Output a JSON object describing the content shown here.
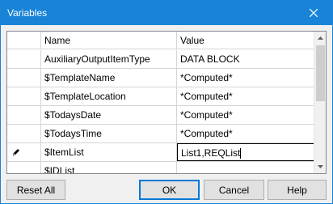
{
  "window": {
    "title": "Variables"
  },
  "grid": {
    "columns": [
      "Name",
      "Value"
    ],
    "rows": [
      {
        "name": "AuxiliaryOutputItemType",
        "value": "DATA BLOCK"
      },
      {
        "name": "$TemplateName",
        "value": "*Computed*"
      },
      {
        "name": "$TemplateLocation",
        "value": "*Computed*"
      },
      {
        "name": "$TodaysDate",
        "value": "*Computed*"
      },
      {
        "name": "$TodaysTime",
        "value": "*Computed*"
      },
      {
        "name": "$ItemList",
        "value": "List1,REQList"
      },
      {
        "name": "$IDList",
        "value": ""
      }
    ]
  },
  "buttons": {
    "reset": "Reset All",
    "ok": "OK",
    "cancel": "Cancel",
    "help": "Help"
  },
  "colors": {
    "accent": "#1883d7",
    "grid_line": "#d5d5d5"
  },
  "icons": {
    "close": "close-icon",
    "edit_row": "pencil-icon"
  }
}
